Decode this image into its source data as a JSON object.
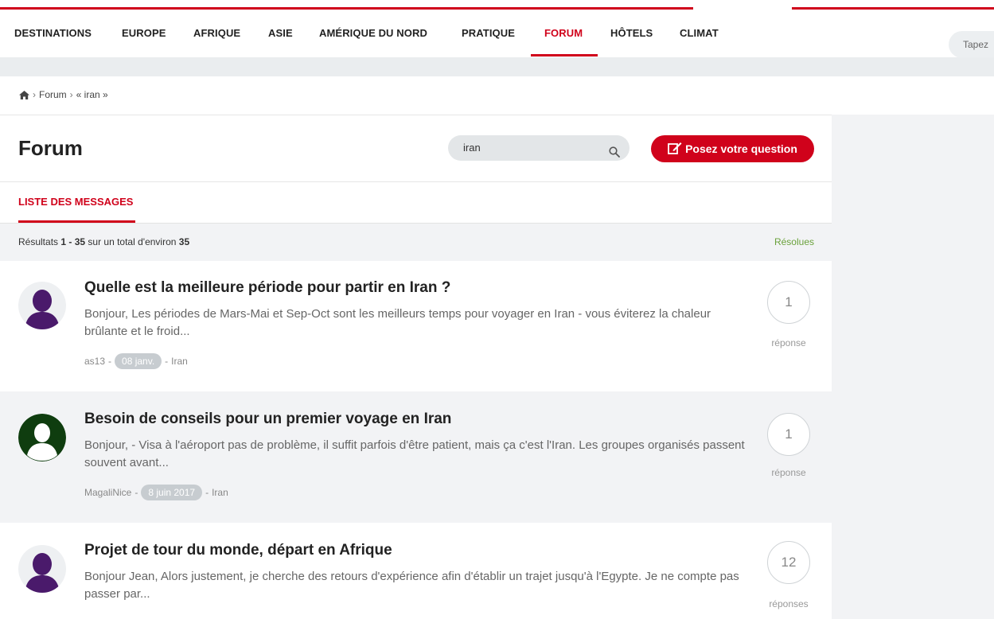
{
  "nav": {
    "items": [
      {
        "label": "DESTINATIONS",
        "active": false
      },
      {
        "label": "EUROPE",
        "active": false
      },
      {
        "label": "AFRIQUE",
        "active": false
      },
      {
        "label": "ASIE",
        "active": false
      },
      {
        "label": "AMÉRIQUE DU NORD",
        "active": false
      },
      {
        "label": "PRATIQUE",
        "active": false
      },
      {
        "label": "FORUM",
        "active": true
      },
      {
        "label": "HÔTELS",
        "active": false
      },
      {
        "label": "CLIMAT",
        "active": false
      }
    ],
    "search_placeholder": "Tapez"
  },
  "breadcrumb": {
    "home_icon": "home-icon",
    "items": [
      "Forum",
      "« iran »"
    ]
  },
  "page": {
    "title": "Forum",
    "search_value": "iran",
    "ask_label": "Posez votre question",
    "tab_label": "LISTE DES MESSAGES"
  },
  "results": {
    "prefix": "Résultats",
    "range": "1 - 35",
    "middle": "sur un total d'environ",
    "total": "35",
    "resolved_label": "Résolues"
  },
  "posts": [
    {
      "title": "Quelle est la meilleure période pour partir en Iran ?",
      "excerpt": "Bonjour, Les périodes de Mars-Mai et Sep-Oct sont les meilleurs temps pour voyager en Iran - vous éviterez la chaleur brûlante et le froid...",
      "author": "as13",
      "date": "08 janv.",
      "destination": "Iran",
      "replies": "1",
      "replies_label": "réponse",
      "avatar_color": "#4a1a6b"
    },
    {
      "title": "Besoin de conseils pour un premier voyage en Iran",
      "excerpt": "Bonjour, - Visa à l'aéroport pas de problème, il suffit parfois d'être patient, mais ça c'est l'Iran. Les groupes organisés passent souvent avant...",
      "author": "MagaliNice",
      "date": "8 juin 2017",
      "destination": "Iran",
      "replies": "1",
      "replies_label": "réponse",
      "avatar_color": "#0f3d0f"
    },
    {
      "title": "Projet de tour du monde, départ en Afrique",
      "excerpt": "Bonjour Jean, Alors justement, je cherche des retours d'expérience afin d'établir un trajet jusqu'à l'Egypte. Je ne compte pas passer par...",
      "author": "",
      "date": "",
      "destination": "",
      "replies": "12",
      "replies_label": "réponses",
      "avatar_color": "#4a1a6b"
    }
  ],
  "colors": {
    "accent": "#d0021b",
    "resolved": "#6aa13b"
  }
}
